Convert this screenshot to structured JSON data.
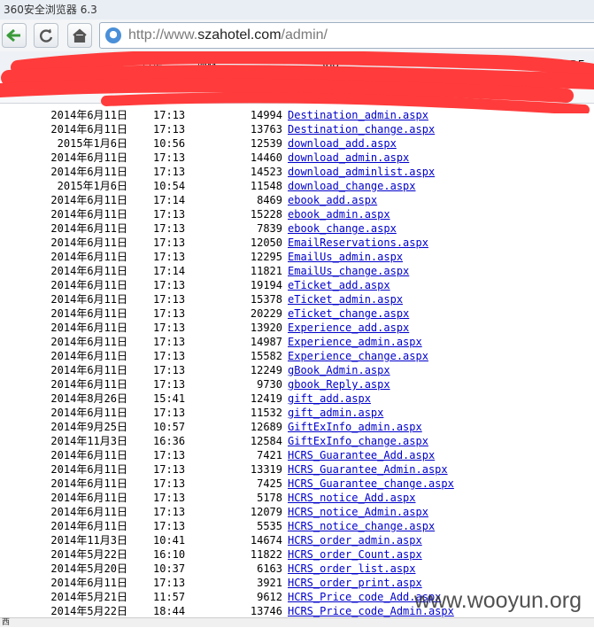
{
  "window": {
    "title": "360安全浏览器 6.3"
  },
  "address_bar": {
    "url_prefix": "http://www.",
    "url_domain": "szahotel.com",
    "url_path": "/admin/"
  },
  "bookmarks": [
    "谷歌",
    "网址大全",
    "日报",
    "搜M",
    "360",
    "W",
    "IDE"
  ],
  "toolbar2": {
    "left_text": "五"
  },
  "listing": [
    {
      "date": "2014年6月11日",
      "time": "17:13",
      "size": "14994",
      "file": "Destination_admin.aspx"
    },
    {
      "date": "2014年6月11日",
      "time": "17:13",
      "size": "13763",
      "file": "Destination_change.aspx"
    },
    {
      "date": "2015年1月6日",
      "time": "10:56",
      "size": "12539",
      "file": "download_add.aspx"
    },
    {
      "date": "2014年6月11日",
      "time": "17:13",
      "size": "14460",
      "file": "download_admin.aspx"
    },
    {
      "date": "2014年6月11日",
      "time": "17:13",
      "size": "14523",
      "file": "download_adminlist.aspx"
    },
    {
      "date": "2015年1月6日",
      "time": "10:54",
      "size": "11548",
      "file": "download_change.aspx"
    },
    {
      "date": "2014年6月11日",
      "time": "17:14",
      "size": "8469",
      "file": "ebook_add.aspx"
    },
    {
      "date": "2014年6月11日",
      "time": "17:13",
      "size": "15228",
      "file": "ebook_admin.aspx"
    },
    {
      "date": "2014年6月11日",
      "time": "17:13",
      "size": "7839",
      "file": "ebook_change.aspx"
    },
    {
      "date": "2014年6月11日",
      "time": "17:13",
      "size": "12050",
      "file": "EmailReservations.aspx"
    },
    {
      "date": "2014年6月11日",
      "time": "17:13",
      "size": "12295",
      "file": "EmailUs_admin.aspx"
    },
    {
      "date": "2014年6月11日",
      "time": "17:14",
      "size": "11821",
      "file": "EmailUs_change.aspx"
    },
    {
      "date": "2014年6月11日",
      "time": "17:13",
      "size": "19194",
      "file": "eTicket_add.aspx"
    },
    {
      "date": "2014年6月11日",
      "time": "17:13",
      "size": "15378",
      "file": "eTicket_admin.aspx"
    },
    {
      "date": "2014年6月11日",
      "time": "17:13",
      "size": "20229",
      "file": "eTicket_change.aspx"
    },
    {
      "date": "2014年6月11日",
      "time": "17:13",
      "size": "13920",
      "file": "Experience_add.aspx"
    },
    {
      "date": "2014年6月11日",
      "time": "17:13",
      "size": "14987",
      "file": "Experience_admin.aspx"
    },
    {
      "date": "2014年6月11日",
      "time": "17:13",
      "size": "15582",
      "file": "Experience_change.aspx"
    },
    {
      "date": "2014年6月11日",
      "time": "17:13",
      "size": "12249",
      "file": "gBook_Admin.aspx"
    },
    {
      "date": "2014年6月11日",
      "time": "17:13",
      "size": "9730",
      "file": "gbook_Reply.aspx"
    },
    {
      "date": "2014年8月26日",
      "time": "15:41",
      "size": "12419",
      "file": "gift_add.aspx"
    },
    {
      "date": "2014年6月11日",
      "time": "17:13",
      "size": "11532",
      "file": "gift_admin.aspx"
    },
    {
      "date": "2014年9月25日",
      "time": "10:57",
      "size": "12689",
      "file": "GiftExInfo_admin.aspx"
    },
    {
      "date": "2014年11月3日",
      "time": "16:36",
      "size": "12584",
      "file": "GiftExInfo_change.aspx"
    },
    {
      "date": "2014年6月11日",
      "time": "17:13",
      "size": "7421",
      "file": "HCRS_Guarantee_Add.aspx"
    },
    {
      "date": "2014年6月11日",
      "time": "17:13",
      "size": "13319",
      "file": "HCRS_Guarantee_Admin.aspx"
    },
    {
      "date": "2014年6月11日",
      "time": "17:13",
      "size": "7425",
      "file": "HCRS_Guarantee_change.aspx"
    },
    {
      "date": "2014年6月11日",
      "time": "17:13",
      "size": "5178",
      "file": "HCRS_notice_Add.aspx"
    },
    {
      "date": "2014年6月11日",
      "time": "17:13",
      "size": "12079",
      "file": "HCRS_notice_Admin.aspx"
    },
    {
      "date": "2014年6月11日",
      "time": "17:13",
      "size": "5535",
      "file": "HCRS_notice_change.aspx"
    },
    {
      "date": "2014年11月3日",
      "time": "10:41",
      "size": "14674",
      "file": "HCRS_order_admin.aspx"
    },
    {
      "date": "2014年5月22日",
      "time": "16:10",
      "size": "11822",
      "file": "HCRS_order_Count.aspx"
    },
    {
      "date": "2014年5月20日",
      "time": "10:37",
      "size": "6163",
      "file": "HCRS_order_list.aspx"
    },
    {
      "date": "2014年6月11日",
      "time": "17:13",
      "size": "3921",
      "file": "HCRS_order_print.aspx"
    },
    {
      "date": "2014年5月21日",
      "time": "11:57",
      "size": "9612",
      "file": "HCRS_Price_code_Add.aspx"
    },
    {
      "date": "2014年5月22日",
      "time": "18:44",
      "size": "13746",
      "file": "HCRS_Price_code_Admin.aspx"
    }
  ],
  "watermark": "www.wooyun.org",
  "status": {
    "text": "西"
  },
  "colors": {
    "link": "#0000cc",
    "redaction": "#ff3b3b"
  }
}
